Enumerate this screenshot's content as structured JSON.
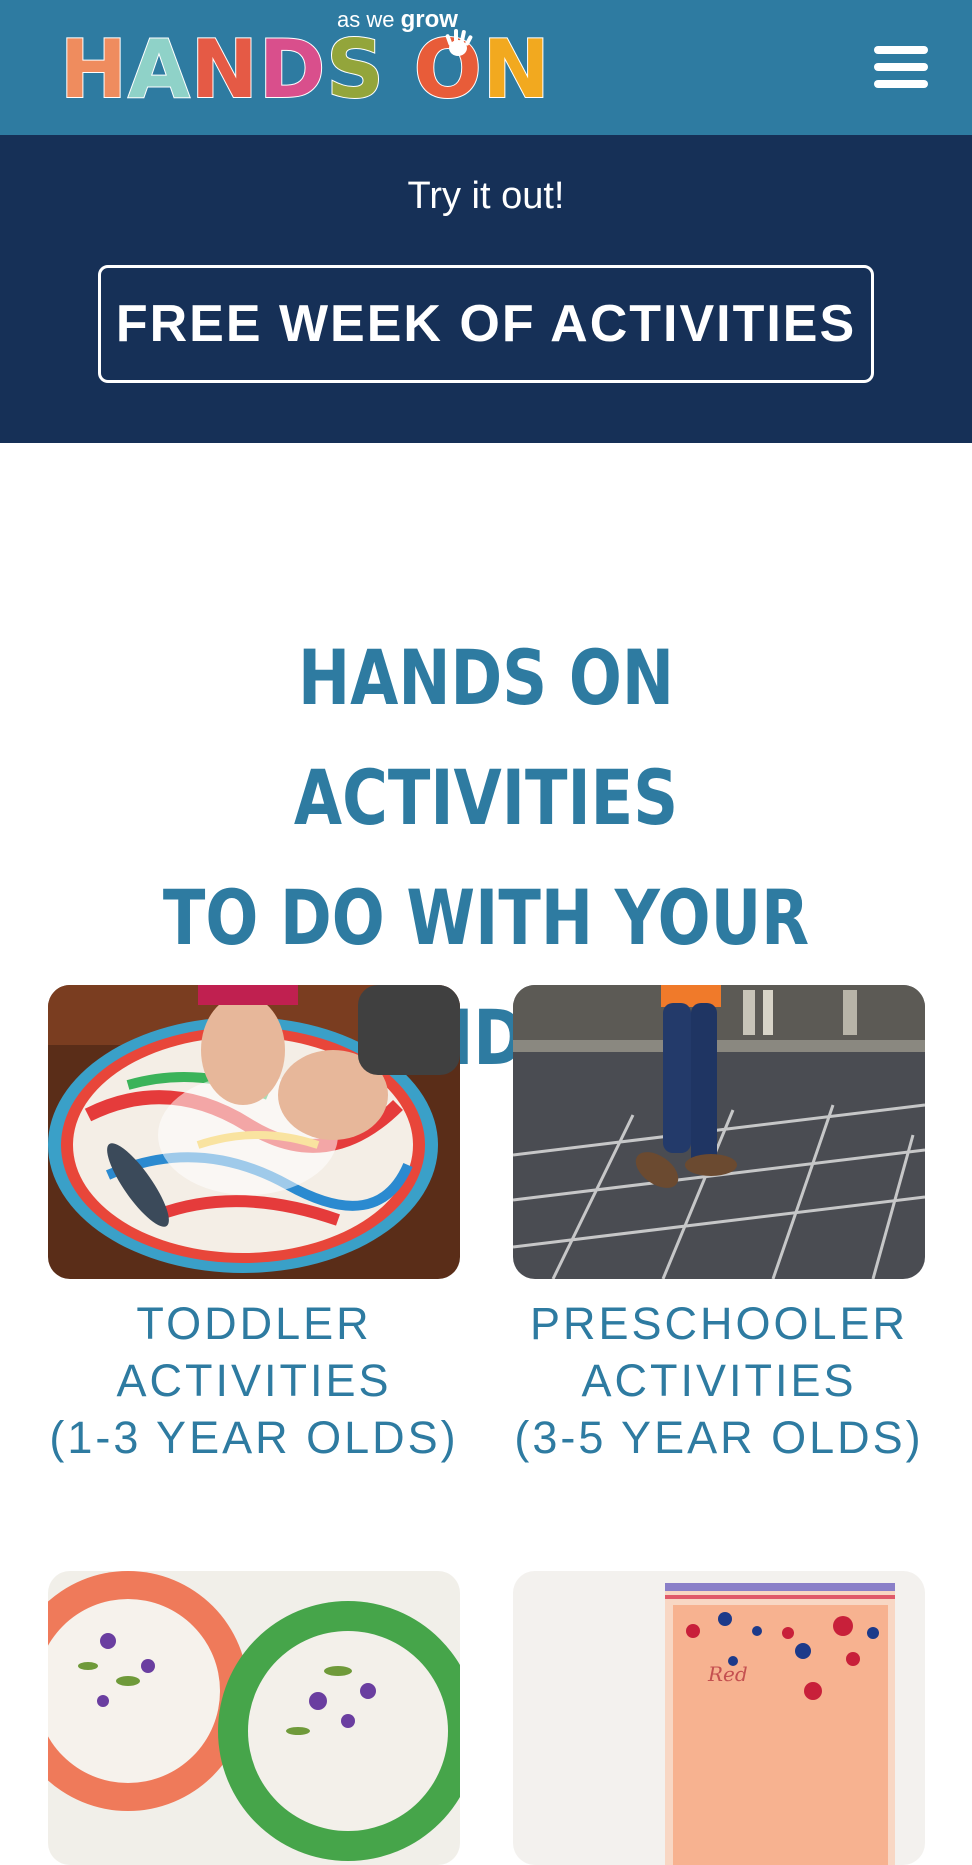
{
  "header": {
    "logo": {
      "letters": [
        {
          "ch": "H",
          "color": "#ef8c5e"
        },
        {
          "ch": "A",
          "color": "#8fd2c8"
        },
        {
          "ch": "N",
          "color": "#e55a45"
        },
        {
          "ch": "D",
          "color": "#d94f8c"
        },
        {
          "ch": "S",
          "color": "#93a53b"
        },
        {
          "ch": " ",
          "color": "#ffffff"
        },
        {
          "ch": "O",
          "color": "#e85c39"
        },
        {
          "ch": "N",
          "color": "#f2a91f"
        }
      ],
      "tagline_prefix": "as we",
      "tagline_emph": "grow",
      "icon": "handprint-icon"
    },
    "menu_icon": "hamburger-menu-icon",
    "background": "#2e7ba1"
  },
  "promo": {
    "text": "Try it out!",
    "button_label": "FREE WEEK OF ACTIVITIES",
    "background": "#163057"
  },
  "main": {
    "heading_line1": "HANDS ON ACTIVITIES",
    "heading_line2": "TO DO WITH YOUR KIDS",
    "accent": "#2e7ba1"
  },
  "cards": [
    {
      "line1": "TODDLER",
      "line2": "ACTIVITIES",
      "line3": "(1-3 YEAR OLDS)"
    },
    {
      "line1": "PRESCHOOLER",
      "line2": "ACTIVITIES",
      "line3": "(3-5 YEAR OLDS)"
    },
    {},
    {}
  ]
}
